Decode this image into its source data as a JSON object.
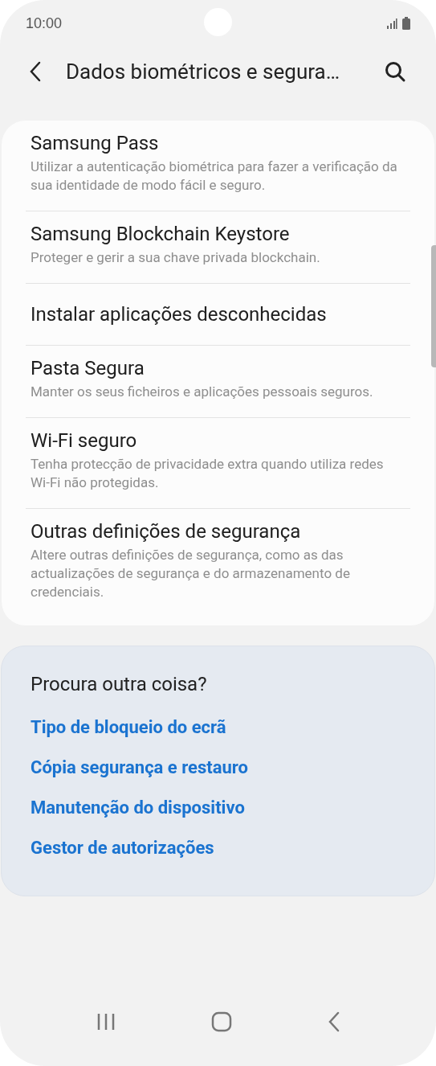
{
  "status_bar": {
    "time": "10:00"
  },
  "header": {
    "title": "Dados biométricos e segura…"
  },
  "settings": [
    {
      "title": "Samsung Pass",
      "description": "Utilizar a autenticação biométrica para fazer a verificação da sua identidade de modo fácil e seguro."
    },
    {
      "title": "Samsung Blockchain Keystore",
      "description": "Proteger e gerir a sua chave privada blockchain."
    },
    {
      "title": "Instalar aplicações desconhecidas"
    },
    {
      "title": "Pasta Segura",
      "description": "Manter os seus ficheiros e aplicações pessoais seguros."
    },
    {
      "title": "Wi-Fi seguro",
      "description": "Tenha protecção de privacidade extra quando utiliza redes Wi-Fi não protegidas."
    },
    {
      "title": "Outras definições de segurança",
      "description": "Altere outras definições de segurança, como as das actualizações de segurança e do armazenamento de credenciais."
    }
  ],
  "suggestions": {
    "title": "Procura outra coisa?",
    "links": [
      "Tipo de bloqueio do ecrã",
      "Cópia segurança e restauro",
      "Manutenção do dispositivo",
      "Gestor de autorizações"
    ]
  }
}
